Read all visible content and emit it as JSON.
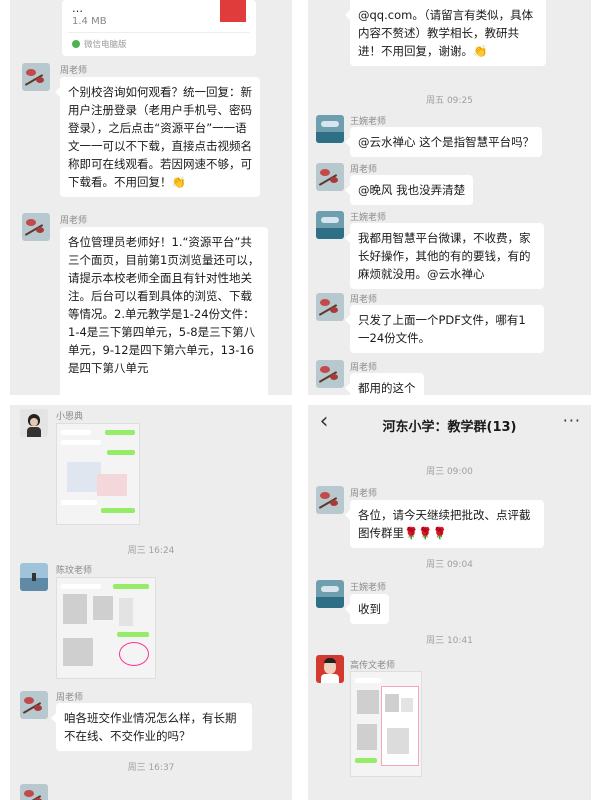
{
  "panel1": {
    "file_card": {
      "title": "…",
      "size": "1.4 MB",
      "source": "微信电脑版"
    },
    "messages": [
      {
        "sender": "周老师",
        "text": "个别校咨询如何观看？统一回复：新用户注册登录（老用户手机号、密码登录），之后点击“资源平台”一一语文一一可以不下载，直接点击视频名称即可在线观看。若因网速不够，可下载看。不用回复！👏"
      },
      {
        "sender": "周老师",
        "text": "各位管理员老师好！1.“资源平台”共三个面页，目前第1页浏览量还可以，请提示本校老师全面且有针对性地关注。后台可以看到具体的浏览、下载等情况。2.单元教学是1-24份文件：1-4是三下第四单元，5-8是三下第八单元，9-12是四下第六单元，13-16是四下第八单元"
      }
    ]
  },
  "panel2": {
    "messages": [
      {
        "sender": "",
        "text": "@qq.com。（请留言有类似，具体内容不赘述）教学相长，教研共进！不用回复，谢谢。👏"
      },
      {
        "time": "周五 09:25"
      },
      {
        "sender": "王婉老师",
        "text": "@云水禅心 这个是指智慧平台吗？"
      },
      {
        "sender": "周老师",
        "text": "@晚风 我也没弄清楚"
      },
      {
        "sender": "王婉老师",
        "text": "我都用智慧平台微课，不收费，家长好操作，其他的有的要钱，有的麻烦就没用。@云水禅心"
      },
      {
        "sender": "周老师",
        "text": "只发了上面一个PDF文件，哪有1一24份文件。"
      },
      {
        "sender": "周老师",
        "text": "都用的这个"
      }
    ]
  },
  "panel3": {
    "messages": [
      {
        "sender": "小恩典",
        "image": "screenshot"
      },
      {
        "time": "周三 16:24"
      },
      {
        "sender": "陈玟老师",
        "image": "screenshot"
      },
      {
        "sender": "周老师",
        "text": "咱各班交作业情况怎么样，有长期不在线、不交作业的吗？"
      },
      {
        "time": "周三 16:37"
      }
    ]
  },
  "panel4": {
    "header": {
      "title": "河东小学：教学群(13)",
      "back_icon": "chevron-left-icon",
      "more_icon": "more-icon"
    },
    "messages": [
      {
        "time": "周三 09:00"
      },
      {
        "sender": "周老师",
        "text": "各位，请今天继续把批改、点评截图传群里🌹🌹🌹"
      },
      {
        "time": "周三 09:04"
      },
      {
        "sender": "王婉老师",
        "text": "收到"
      },
      {
        "time": "周三 10:41"
      },
      {
        "sender": "高传文老师",
        "image": "screenshot"
      }
    ]
  }
}
